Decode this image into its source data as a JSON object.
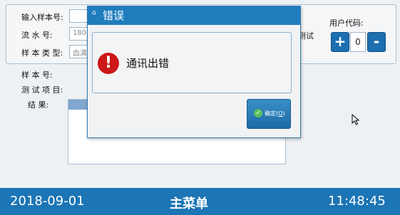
{
  "form": {
    "sample_input_label": "输入样本号:",
    "serial_label": "流 水 号:",
    "serial_value": "180",
    "sample_type_label": "样 本 类 型:",
    "sample_type_value": "血清",
    "side_button_label": "测试"
  },
  "user_code": {
    "title": "用户代码:",
    "plus": "+",
    "value": "0",
    "minus": "-"
  },
  "info": {
    "sample_no_label": "样 本 号:",
    "test_item_label": "测 试 项 目:",
    "result_label": "结    果:"
  },
  "dialog": {
    "title_icon": "⌂",
    "title": "错误",
    "error_icon_glyph": "!",
    "message": "通讯出错",
    "ok_check_glyph": "✓",
    "ok_label_prefix": "确定(",
    "ok_label_hotkey": "O",
    "ok_label_suffix": ")"
  },
  "status": {
    "date": "2018-09-01",
    "menu": "主菜单",
    "time": "11:48:45"
  },
  "colors": {
    "accent": "#1c75b5",
    "error": "#cc1818"
  }
}
